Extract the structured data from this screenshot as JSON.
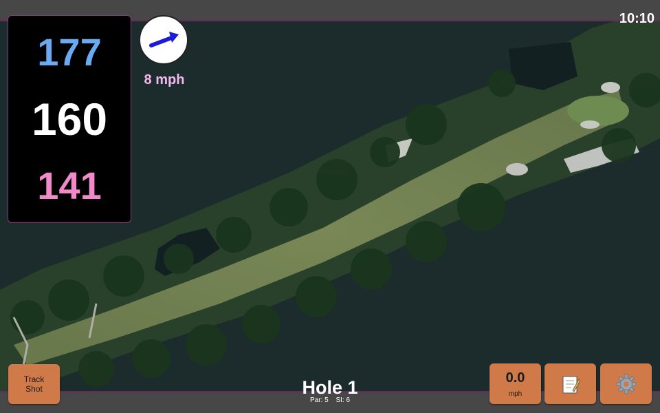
{
  "status_bar": {
    "time": "10:10"
  },
  "distances": {
    "back": "177",
    "middle": "160",
    "front": "141"
  },
  "wind": {
    "speed_label": "8 mph",
    "icon": "wind-arrow-icon"
  },
  "hole": {
    "title": "Hole 1",
    "par": "Par: 5",
    "si": "SI: 6"
  },
  "buttons": {
    "track_shot": "Track\nShot",
    "speed_value": "0.0",
    "speed_unit": "mph",
    "notes_icon": "notepad-icon",
    "settings_icon": "gear-icon"
  },
  "colors": {
    "back": "#6aaaf2",
    "middle": "#ffffff",
    "front": "#f08ac8",
    "button": "#cf7a48",
    "wind_text": "#f5b8ee"
  }
}
